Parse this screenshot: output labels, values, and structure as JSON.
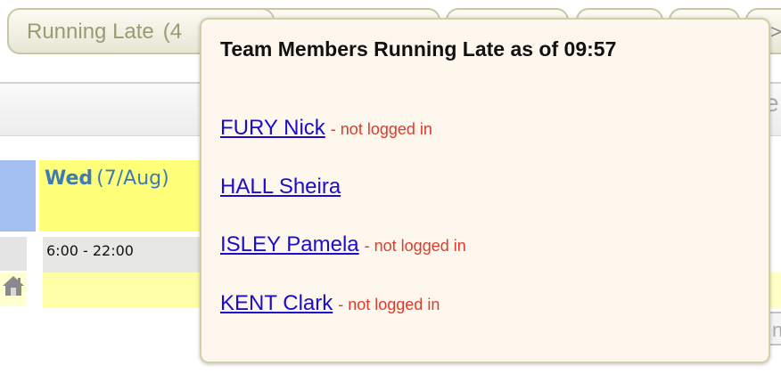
{
  "tabs": {
    "running_late": {
      "label": "Running Late",
      "count": "(4"
    },
    "more_glyph": ">>"
  },
  "calendar": {
    "day": {
      "name": "Wed",
      "date": "(7/Aug)"
    },
    "shift_time": "6:00 - 22:00",
    "right_fragment": "e",
    "right_button_fragment": "n"
  },
  "popup": {
    "title": "Team Members Running Late as of 09:57",
    "members": [
      {
        "name": "FURY Nick",
        "status": "- not logged in"
      },
      {
        "name": "HALL Sheira",
        "status": ""
      },
      {
        "name": "ISLEY Pamela",
        "status": "- not logged in"
      },
      {
        "name": "KENT Clark",
        "status": "- not logged in"
      }
    ]
  },
  "colors": {
    "link": "#1a0dcc",
    "status_red": "#e03a2a",
    "day_header_yellow": "#ffff7a",
    "blue_column": "#a3bff2"
  }
}
